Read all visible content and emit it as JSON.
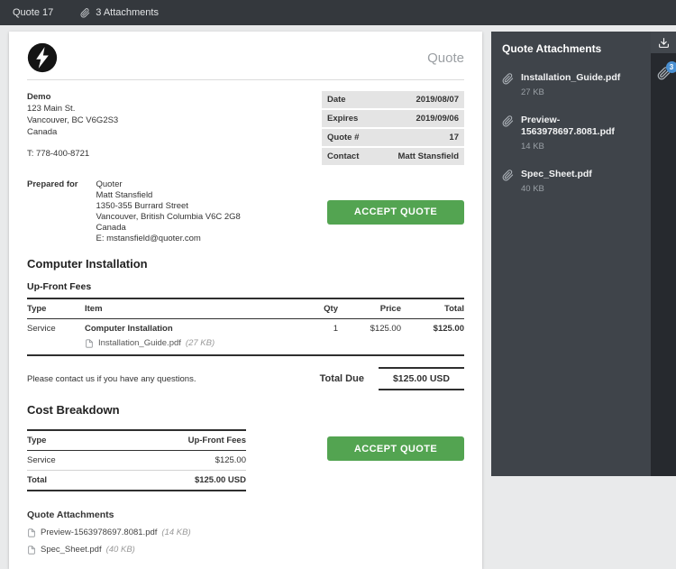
{
  "colors": {
    "accent_green": "#53a451",
    "badge_blue": "#4a90d2"
  },
  "topbar": {
    "quote_tab": "Quote 17",
    "attachments_toggle": "3 Attachments"
  },
  "document": {
    "title": "Quote",
    "company": {
      "name": "Demo",
      "address1": "123 Main St.",
      "address2": "Vancouver, BC V6G2S3",
      "address3": "Canada",
      "phone": "T: 778-400-8721"
    },
    "meta": [
      {
        "label": "Date",
        "value": "2019/08/07"
      },
      {
        "label": "Expires",
        "value": "2019/09/06"
      },
      {
        "label": "Quote #",
        "value": "17"
      },
      {
        "label": "Contact",
        "value": "Matt Stansfield"
      }
    ],
    "prepared_for": {
      "label": "Prepared for",
      "line1": "Quoter",
      "line2": "Matt Stansfield",
      "line3": "1350-355 Burrard Street",
      "line4": "Vancouver, British Columbia V6C 2G8",
      "line5": "Canada",
      "line6": "E: mstansfield@quoter.com"
    },
    "accept_button": "ACCEPT QUOTE",
    "section_title": "Computer Installation",
    "fees_subtitle": "Up-Front Fees",
    "items_table": {
      "headers": {
        "type": "Type",
        "item": "Item",
        "qty": "Qty",
        "price": "Price",
        "total": "Total"
      },
      "row": {
        "type": "Service",
        "item": "Computer Installation",
        "qty": "1",
        "price": "$125.00",
        "total": "$125.00",
        "attachment_name": "Installation_Guide.pdf",
        "attachment_size": "(27 KB)"
      }
    },
    "note": "Please contact us if you have any questions.",
    "total_due": {
      "label": "Total Due",
      "value": "$125.00 USD"
    },
    "cost_breakdown": {
      "title": "Cost Breakdown",
      "col_type": "Type",
      "col_fees": "Up-Front Fees",
      "rows": [
        {
          "label": "Service",
          "value": "$125.00"
        },
        {
          "label": "Total",
          "value": "$125.00 USD"
        }
      ]
    },
    "attachments": {
      "title": "Quote Attachments",
      "files": [
        {
          "name": "Preview-1563978697.8081.pdf",
          "size": "(14 KB)"
        },
        {
          "name": "Spec_Sheet.pdf",
          "size": "(40 KB)"
        }
      ]
    }
  },
  "sidebar": {
    "title": "Quote Attachments",
    "badge_count": "3",
    "files": [
      {
        "name": "Installation_Guide.pdf",
        "size": "27 KB"
      },
      {
        "name": "Preview-1563978697.8081.pdf",
        "size": "14 KB"
      },
      {
        "name": "Spec_Sheet.pdf",
        "size": "40 KB"
      }
    ]
  }
}
